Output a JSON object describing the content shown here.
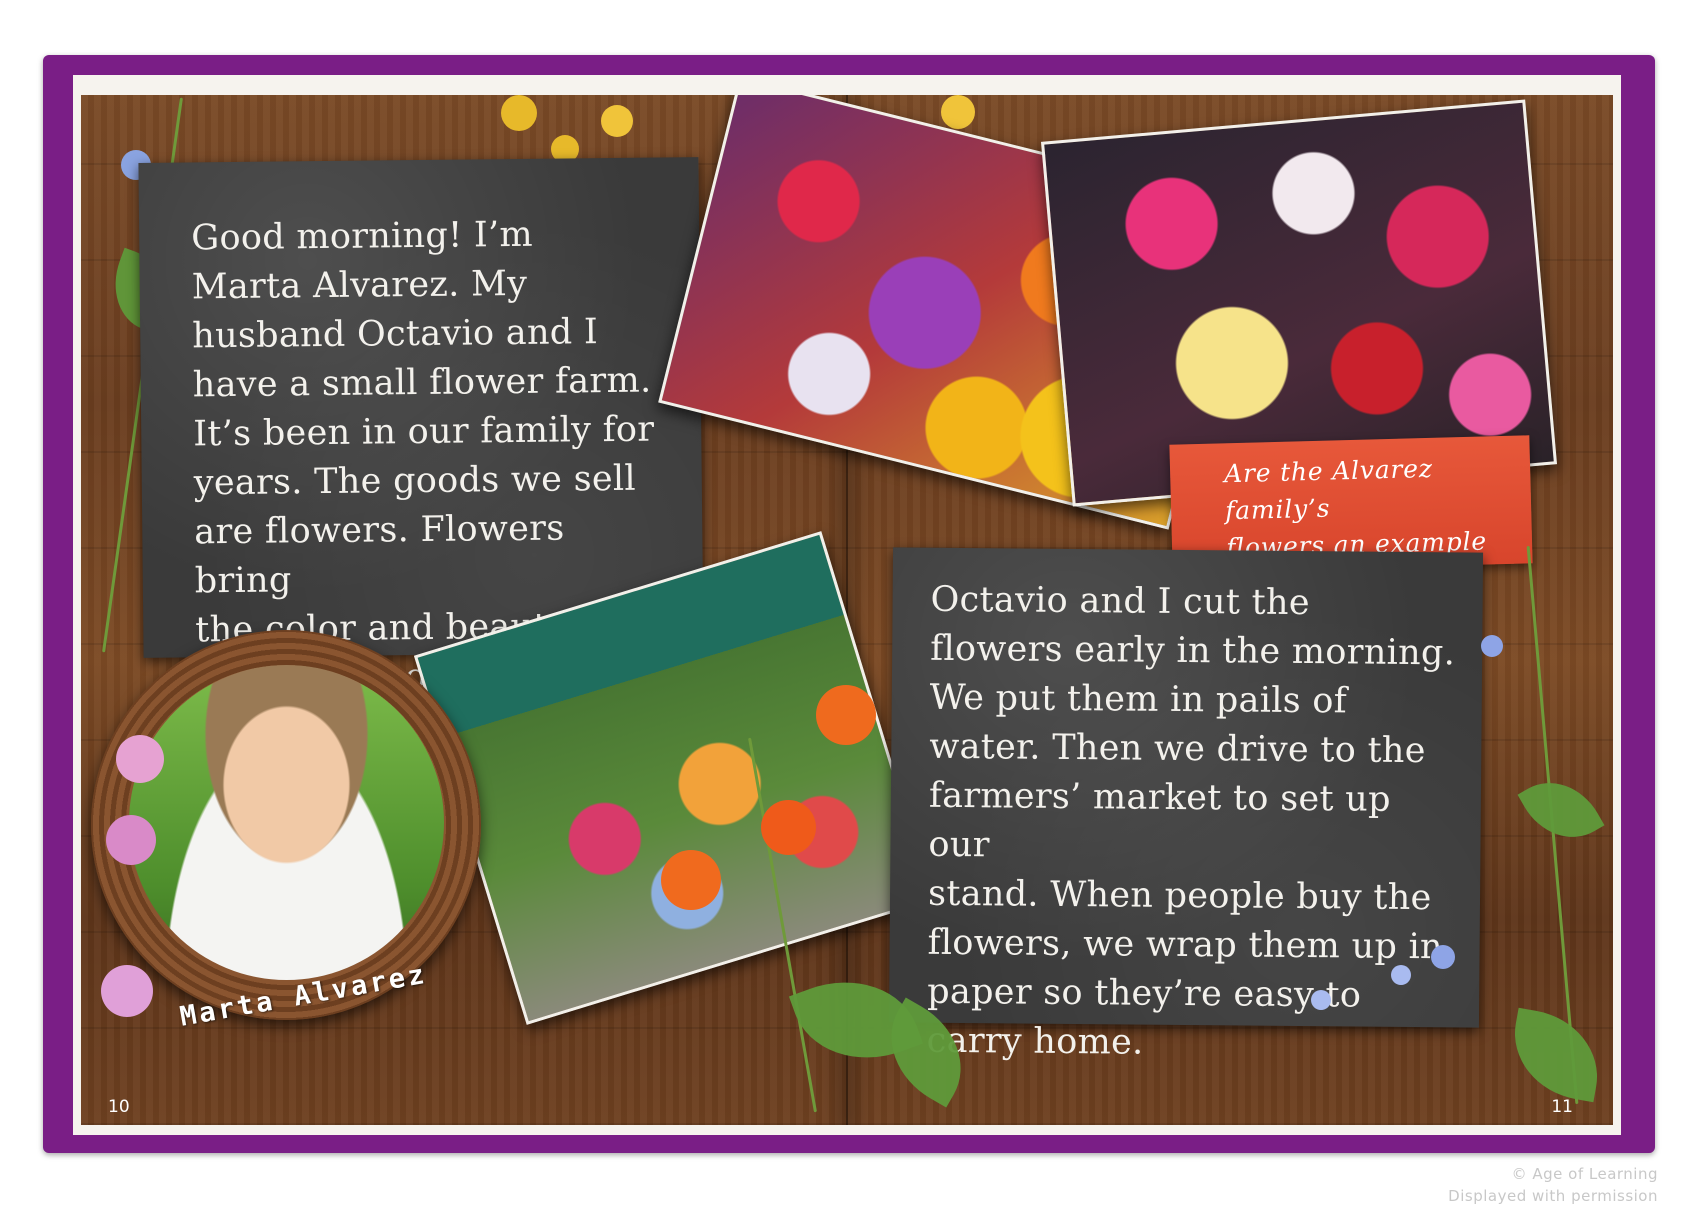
{
  "book": {
    "left_page": {
      "text": "Good morning! I’m\nMarta Alvarez. My\nhusband Octavio and I\nhave a small flower farm.\nIt’s been in our family for\nyears. The goods we sell\nare flowers. Flowers bring\nthe color and beauty of\nnature indoors.",
      "portrait_caption": "Marta Alvarez",
      "page_number": "10"
    },
    "right_page": {
      "question": "Are the Alvarez family’s\nflowers an example of a\nneed or a want?",
      "text": "Octavio and I cut the\nflowers early in the morning.\nWe put them in pails of\nwater. Then we drive to the\nfarmers’ market to set up our\nstand. When people buy the\nflowers, we wrap them up in\npaper so they’re easy to\ncarry home.",
      "page_number": "11"
    },
    "colors": {
      "cover": "#7a1e86",
      "chalkboard": "#3a3a3a",
      "callout": "#e7583a"
    }
  },
  "footer": {
    "copyright": "© Age of Learning",
    "permission": "Displayed with permission"
  }
}
